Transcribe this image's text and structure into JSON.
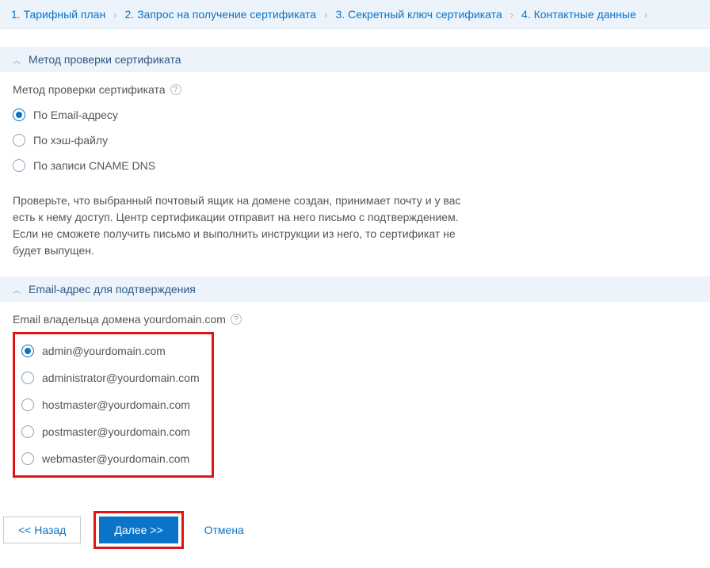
{
  "breadcrumb": {
    "items": [
      "1. Тарифный план",
      "2. Запрос на получение сертификата",
      "3. Секретный ключ сертификата",
      "4. Контактные данные"
    ]
  },
  "section_method": {
    "title": "Метод проверки сертификата",
    "field_label": "Метод проверки сертификата",
    "options": [
      "По Email-адресу",
      "По хэш-файлу",
      "По записи CNAME DNS"
    ]
  },
  "info_text": "Проверьте, что выбранный почтовый ящик на домене создан, принимает почту и у вас есть к нему доступ. Центр сертификации отправит на него письмо с подтверждением. Если не сможете получить письмо и выполнить инструкции из него, то сертификат не будет выпущен.",
  "section_email": {
    "title": "Email-адрес для подтверждения",
    "field_label": "Email владельца домена yourdomain.com",
    "options": [
      "admin@yourdomain.com",
      "administrator@yourdomain.com",
      "hostmaster@yourdomain.com",
      "postmaster@yourdomain.com",
      "webmaster@yourdomain.com"
    ]
  },
  "buttons": {
    "back": "<< Назад",
    "next": "Далее >>",
    "cancel": "Отмена"
  }
}
